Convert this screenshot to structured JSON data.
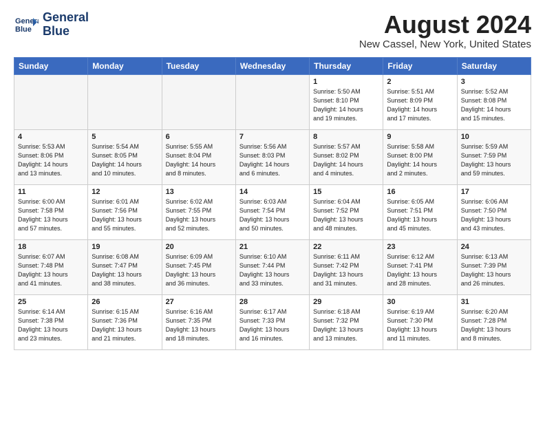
{
  "header": {
    "logo_line1": "General",
    "logo_line2": "Blue",
    "month_year": "August 2024",
    "location": "New Cassel, New York, United States"
  },
  "weekdays": [
    "Sunday",
    "Monday",
    "Tuesday",
    "Wednesday",
    "Thursday",
    "Friday",
    "Saturday"
  ],
  "weeks": [
    [
      {
        "day": "",
        "info": ""
      },
      {
        "day": "",
        "info": ""
      },
      {
        "day": "",
        "info": ""
      },
      {
        "day": "",
        "info": ""
      },
      {
        "day": "1",
        "info": "Sunrise: 5:50 AM\nSunset: 8:10 PM\nDaylight: 14 hours\nand 19 minutes."
      },
      {
        "day": "2",
        "info": "Sunrise: 5:51 AM\nSunset: 8:09 PM\nDaylight: 14 hours\nand 17 minutes."
      },
      {
        "day": "3",
        "info": "Sunrise: 5:52 AM\nSunset: 8:08 PM\nDaylight: 14 hours\nand 15 minutes."
      }
    ],
    [
      {
        "day": "4",
        "info": "Sunrise: 5:53 AM\nSunset: 8:06 PM\nDaylight: 14 hours\nand 13 minutes."
      },
      {
        "day": "5",
        "info": "Sunrise: 5:54 AM\nSunset: 8:05 PM\nDaylight: 14 hours\nand 10 minutes."
      },
      {
        "day": "6",
        "info": "Sunrise: 5:55 AM\nSunset: 8:04 PM\nDaylight: 14 hours\nand 8 minutes."
      },
      {
        "day": "7",
        "info": "Sunrise: 5:56 AM\nSunset: 8:03 PM\nDaylight: 14 hours\nand 6 minutes."
      },
      {
        "day": "8",
        "info": "Sunrise: 5:57 AM\nSunset: 8:02 PM\nDaylight: 14 hours\nand 4 minutes."
      },
      {
        "day": "9",
        "info": "Sunrise: 5:58 AM\nSunset: 8:00 PM\nDaylight: 14 hours\nand 2 minutes."
      },
      {
        "day": "10",
        "info": "Sunrise: 5:59 AM\nSunset: 7:59 PM\nDaylight: 13 hours\nand 59 minutes."
      }
    ],
    [
      {
        "day": "11",
        "info": "Sunrise: 6:00 AM\nSunset: 7:58 PM\nDaylight: 13 hours\nand 57 minutes."
      },
      {
        "day": "12",
        "info": "Sunrise: 6:01 AM\nSunset: 7:56 PM\nDaylight: 13 hours\nand 55 minutes."
      },
      {
        "day": "13",
        "info": "Sunrise: 6:02 AM\nSunset: 7:55 PM\nDaylight: 13 hours\nand 52 minutes."
      },
      {
        "day": "14",
        "info": "Sunrise: 6:03 AM\nSunset: 7:54 PM\nDaylight: 13 hours\nand 50 minutes."
      },
      {
        "day": "15",
        "info": "Sunrise: 6:04 AM\nSunset: 7:52 PM\nDaylight: 13 hours\nand 48 minutes."
      },
      {
        "day": "16",
        "info": "Sunrise: 6:05 AM\nSunset: 7:51 PM\nDaylight: 13 hours\nand 45 minutes."
      },
      {
        "day": "17",
        "info": "Sunrise: 6:06 AM\nSunset: 7:50 PM\nDaylight: 13 hours\nand 43 minutes."
      }
    ],
    [
      {
        "day": "18",
        "info": "Sunrise: 6:07 AM\nSunset: 7:48 PM\nDaylight: 13 hours\nand 41 minutes."
      },
      {
        "day": "19",
        "info": "Sunrise: 6:08 AM\nSunset: 7:47 PM\nDaylight: 13 hours\nand 38 minutes."
      },
      {
        "day": "20",
        "info": "Sunrise: 6:09 AM\nSunset: 7:45 PM\nDaylight: 13 hours\nand 36 minutes."
      },
      {
        "day": "21",
        "info": "Sunrise: 6:10 AM\nSunset: 7:44 PM\nDaylight: 13 hours\nand 33 minutes."
      },
      {
        "day": "22",
        "info": "Sunrise: 6:11 AM\nSunset: 7:42 PM\nDaylight: 13 hours\nand 31 minutes."
      },
      {
        "day": "23",
        "info": "Sunrise: 6:12 AM\nSunset: 7:41 PM\nDaylight: 13 hours\nand 28 minutes."
      },
      {
        "day": "24",
        "info": "Sunrise: 6:13 AM\nSunset: 7:39 PM\nDaylight: 13 hours\nand 26 minutes."
      }
    ],
    [
      {
        "day": "25",
        "info": "Sunrise: 6:14 AM\nSunset: 7:38 PM\nDaylight: 13 hours\nand 23 minutes."
      },
      {
        "day": "26",
        "info": "Sunrise: 6:15 AM\nSunset: 7:36 PM\nDaylight: 13 hours\nand 21 minutes."
      },
      {
        "day": "27",
        "info": "Sunrise: 6:16 AM\nSunset: 7:35 PM\nDaylight: 13 hours\nand 18 minutes."
      },
      {
        "day": "28",
        "info": "Sunrise: 6:17 AM\nSunset: 7:33 PM\nDaylight: 13 hours\nand 16 minutes."
      },
      {
        "day": "29",
        "info": "Sunrise: 6:18 AM\nSunset: 7:32 PM\nDaylight: 13 hours\nand 13 minutes."
      },
      {
        "day": "30",
        "info": "Sunrise: 6:19 AM\nSunset: 7:30 PM\nDaylight: 13 hours\nand 11 minutes."
      },
      {
        "day": "31",
        "info": "Sunrise: 6:20 AM\nSunset: 7:28 PM\nDaylight: 13 hours\nand 8 minutes."
      }
    ]
  ]
}
